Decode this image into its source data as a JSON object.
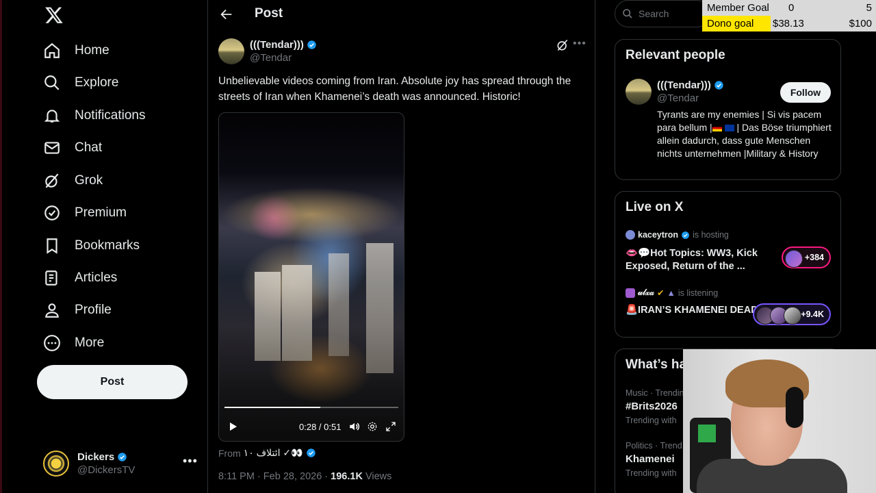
{
  "sidebar": {
    "items": [
      {
        "label": "Home",
        "icon": "home-icon"
      },
      {
        "label": "Explore",
        "icon": "search-icon"
      },
      {
        "label": "Notifications",
        "icon": "bell-icon"
      },
      {
        "label": "Chat",
        "icon": "mail-icon"
      },
      {
        "label": "Grok",
        "icon": "grok-icon"
      },
      {
        "label": "Premium",
        "icon": "verified-badge-icon"
      },
      {
        "label": "Bookmarks",
        "icon": "bookmark-icon"
      },
      {
        "label": "Articles",
        "icon": "article-icon"
      },
      {
        "label": "Profile",
        "icon": "person-icon"
      },
      {
        "label": "More",
        "icon": "more-circle-icon"
      }
    ],
    "post_button": "Post",
    "account": {
      "display_name": "Dickers",
      "handle": "@DickersTV"
    }
  },
  "header": {
    "title": "Post"
  },
  "tweet": {
    "author": {
      "display_name": "(((Tendar)))",
      "handle": "@Tendar"
    },
    "text": "Unbelievable videos coming from Iran. Absolute joy has spread through the streets of Iran when Khamenei’s death was announced. Historic!",
    "video": {
      "time": "0:28 / 0:51",
      "progress": 0.55
    },
    "from_prefix": "From",
    "from_source": "ائتلاف ۱۰ ✓👀",
    "timestamp": "8:11 PM · Feb 28, 2026 · ",
    "views_count": "196.1K",
    "views_label": " Views"
  },
  "search": {
    "placeholder": "Search"
  },
  "relevant_people": {
    "title": "Relevant people",
    "display_name": "(((Tendar)))",
    "handle": "@Tendar",
    "follow_label": "Follow",
    "bio_part1": "Tyrants are my enemies | Si vis pacem para bellum |",
    "bio_part2": " | Das Böse triumphiert allein dadurch, dass gute Menschen nichts unternehmen |Military & History"
  },
  "live": {
    "title": "Live on X",
    "spaces": [
      {
        "user": "kaceytron",
        "action": "is hosting",
        "title": "👄💬Hot Topics: WW3, Kick Exposed, Return of the ...",
        "count": "+384",
        "border": "#f91880"
      },
      {
        "user": "𝓊𝓁𝓍𝒶",
        "action": "is listening",
        "title": "🚨IRAN’S KHAMENEI DEAD",
        "count": "+9.4K",
        "border": "#7856ff"
      }
    ]
  },
  "whats_happening": {
    "title": "What’s ha",
    "trends": [
      {
        "category": "Music · Trendin",
        "name": "#Brits2026",
        "with": "Trending with"
      },
      {
        "category": "Politics · Trend",
        "name": "Khamenei",
        "with": "Trending with"
      }
    ]
  },
  "goal_overlay": {
    "member_label": "Member Goal",
    "member_current": "0",
    "member_target": "5",
    "dono_label": "Dono goal",
    "dono_current": "$38.13",
    "dono_target": "$100"
  },
  "colors": {
    "accent_blue": "#1d9bf0",
    "dono_yellow": "#ffe600",
    "live_pink": "#f91880",
    "live_purple": "#7856ff"
  }
}
